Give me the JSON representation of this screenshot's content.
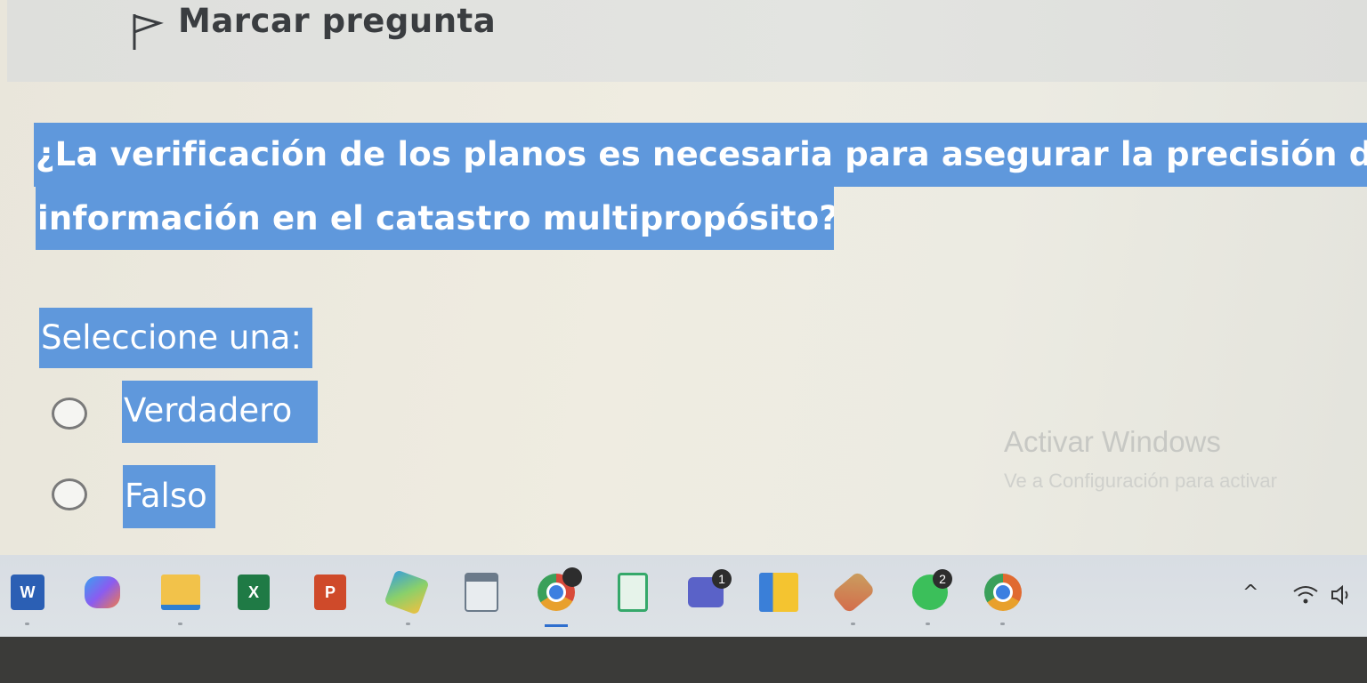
{
  "flag": {
    "label": "Marcar pregunta"
  },
  "question": {
    "line1": "¿La verificación de los planos es necesaria para asegurar la precisión de l",
    "line2": "información en el catastro multipropósito?"
  },
  "prompt": "Seleccione una:",
  "options": [
    {
      "label": "Verdadero",
      "selected": false
    },
    {
      "label": "Falso",
      "selected": false
    }
  ],
  "watermark": {
    "title": "Activar Windows",
    "subtitle": "Ve a Configuración para activar"
  },
  "taskbar": {
    "apps": [
      {
        "icon": "word-icon",
        "glyph": "W",
        "color": "#2b5fb4"
      },
      {
        "icon": "copilot-icon",
        "color": "#8a5cf0"
      },
      {
        "icon": "file-explorer-icon",
        "color": "#f2c24a"
      },
      {
        "icon": "excel-icon",
        "glyph": "X",
        "color": "#1f7a45"
      },
      {
        "icon": "powerpoint-icon",
        "glyph": "P",
        "color": "#cf4a2a"
      },
      {
        "icon": "maps-icon",
        "color": "#3aa0d8"
      },
      {
        "icon": "calculator-icon",
        "color": "#6b7a8a"
      },
      {
        "icon": "chrome-icon",
        "color": "#e8a02c",
        "badge": ""
      },
      {
        "icon": "notepad-icon",
        "color": "#35a86a"
      },
      {
        "icon": "teams-icon",
        "color": "#5a62c8",
        "badge": "1"
      },
      {
        "icon": "sticky-notes-icon",
        "color": "#f4c430"
      },
      {
        "icon": "snipping-tool-icon",
        "color": "#d46a4a"
      },
      {
        "icon": "whatsapp-icon",
        "color": "#3bbf5a",
        "badge": "2"
      },
      {
        "icon": "chrome-icon-2",
        "color": "#e06a30"
      }
    ]
  },
  "tray": {
    "chevron": "^",
    "wifi": "wifi-icon",
    "volume": "volume-icon"
  }
}
